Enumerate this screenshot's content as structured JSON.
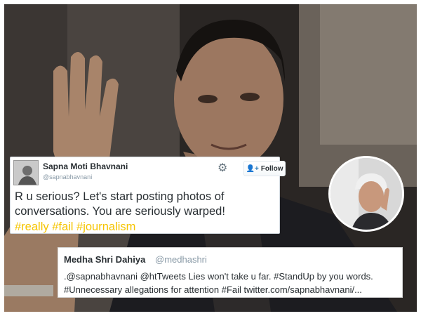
{
  "tweet1": {
    "name": "Sapna Moti Bhavnani",
    "handle": "@sapnabhavnani",
    "follow_label": "Follow",
    "text": "R u serious? Let's start posting photos of conversations. You are seriously warped!",
    "hashtags": "#really #fail #journalism",
    "hashtag_color": "#f5c400"
  },
  "tweet2": {
    "name": "Medha Shri Dahiya",
    "handle": "@medhashri",
    "line1": ".@sapnabhavnani @htTweets Lies won't take u far. #StandUp by you words.",
    "line2": "#Unnecessary allegations for attention #Fail twitter.com/sapnabhavnani/..."
  },
  "icons": {
    "settings": "gear-icon",
    "follow": "add-person-icon"
  }
}
